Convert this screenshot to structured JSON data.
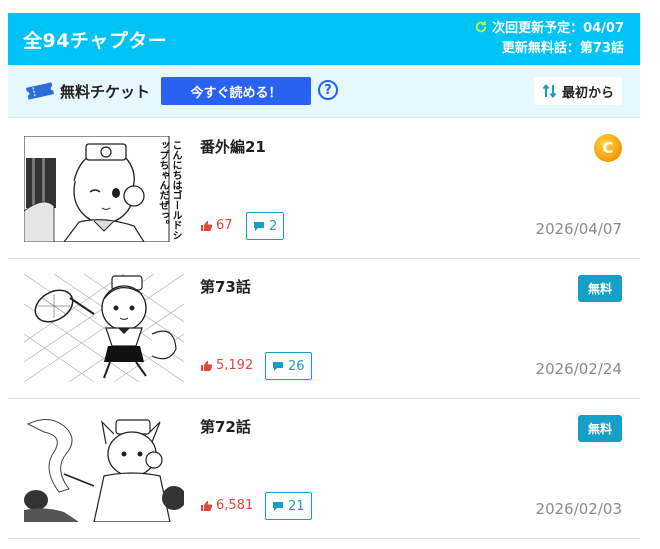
{
  "header": {
    "title": "全94チャプター",
    "next_update": "次回更新予定：04/07",
    "free_latest": "更新無料話：第73話"
  },
  "ticket_bar": {
    "label": "無料チケット",
    "read_now": "今すぐ読める！",
    "help": "?",
    "sort": "最初から"
  },
  "chapters": [
    {
      "title": "番外編21",
      "likes": "67",
      "comments": "2",
      "date": "2026/04/07",
      "badge": "coin",
      "coin_letter": "C"
    },
    {
      "title": "第73話",
      "likes": "5,192",
      "comments": "26",
      "date": "2026/02/24",
      "badge": "無料"
    },
    {
      "title": "第72話",
      "likes": "6,581",
      "comments": "21",
      "date": "2026/02/03",
      "badge": "無料"
    }
  ],
  "thumb_text": {
    "ch0": "こんにちはゴールドシップちゃんだぜっ。"
  },
  "colors": {
    "header_bg": "#00c3f5",
    "ticket_bar_bg": "#e6f7fd",
    "primary_button": "#2962f0",
    "free_badge": "#16a0c8",
    "likes": "#e0473c"
  }
}
